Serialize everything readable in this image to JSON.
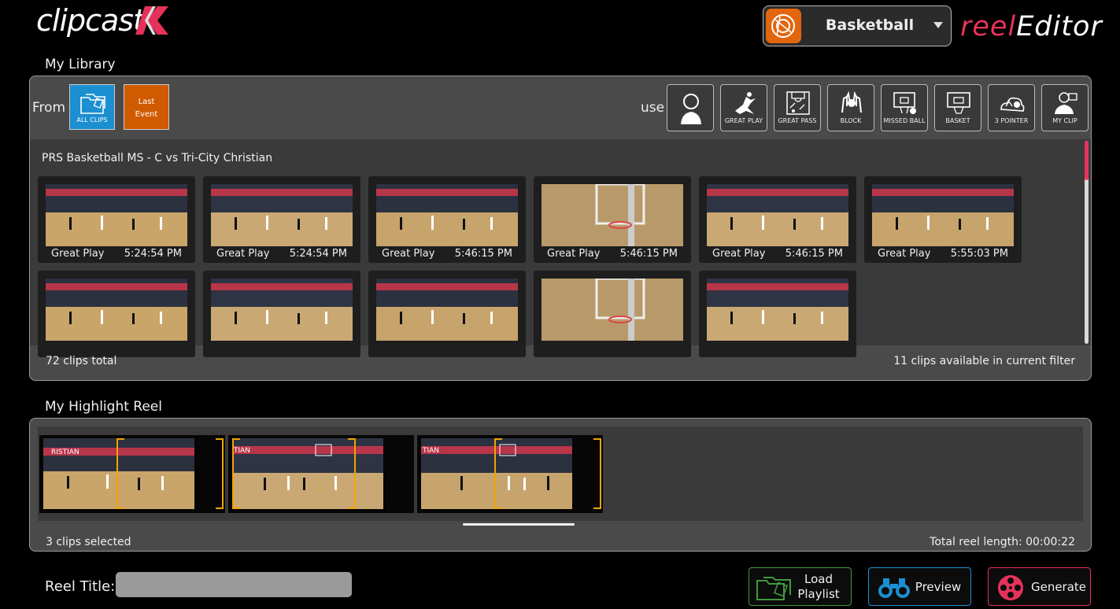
{
  "header": {
    "brand": "clipcast",
    "sport": "Basketball",
    "app_name_prefix": "reel",
    "app_name_suffix": "Editor",
    "sport_icon": "basketball-icon",
    "colors": {
      "accent_pink": "#e6325a",
      "sport_orange": "#e2660e",
      "allclips_blue": "#1b8fd0",
      "lastevent_orange": "#d05a00"
    }
  },
  "library": {
    "title": "My Library",
    "from_label": "From",
    "sources": [
      {
        "label": "ALL CLIPS",
        "icon": "folders-icon"
      },
      {
        "label": "Last Event",
        "icon": ""
      }
    ],
    "use_label": "use",
    "tags": [
      {
        "label": "",
        "icon": "player-icon"
      },
      {
        "label": "GREAT PLAY",
        "icon": "great-play-icon"
      },
      {
        "label": "GREAT PASS",
        "icon": "great-pass-icon"
      },
      {
        "label": "BLOCK",
        "icon": "block-icon"
      },
      {
        "label": "MISSED BALL",
        "icon": "missed-ball-icon"
      },
      {
        "label": "BASKET",
        "icon": "basket-icon"
      },
      {
        "label": "3 POINTER",
        "icon": "three-pointer-icon"
      },
      {
        "label": "MY CLIP",
        "icon": "my-clip-icon"
      }
    ],
    "event_title": "PRS Basketball MS - C vs Tri-City Christian",
    "clips": [
      {
        "type": "Great Play",
        "time": "5:24:54 PM"
      },
      {
        "type": "Great Play",
        "time": "5:24:54 PM"
      },
      {
        "type": "Great Play",
        "time": "5:46:15 PM"
      },
      {
        "type": "Great Play",
        "time": "5:46:15 PM"
      },
      {
        "type": "Great Play",
        "time": "5:46:15 PM"
      },
      {
        "type": "Great Play",
        "time": "5:55:03 PM"
      },
      {
        "type": "",
        "time": ""
      },
      {
        "type": "",
        "time": ""
      },
      {
        "type": "",
        "time": ""
      },
      {
        "type": "",
        "time": ""
      },
      {
        "type": "",
        "time": ""
      }
    ],
    "total_text": "72 clips total",
    "filter_text": "11 clips available in current filter"
  },
  "reel": {
    "title": "My Highlight Reel",
    "selected_text": "3 clips selected",
    "length_text": "Total reel length: 00:00:22"
  },
  "bottom": {
    "reel_title_label": "Reel Title:",
    "reel_title_value": "",
    "load_label_1": "Load",
    "load_label_2": "Playlist",
    "preview_label": "Preview",
    "generate_label": "Generate"
  }
}
